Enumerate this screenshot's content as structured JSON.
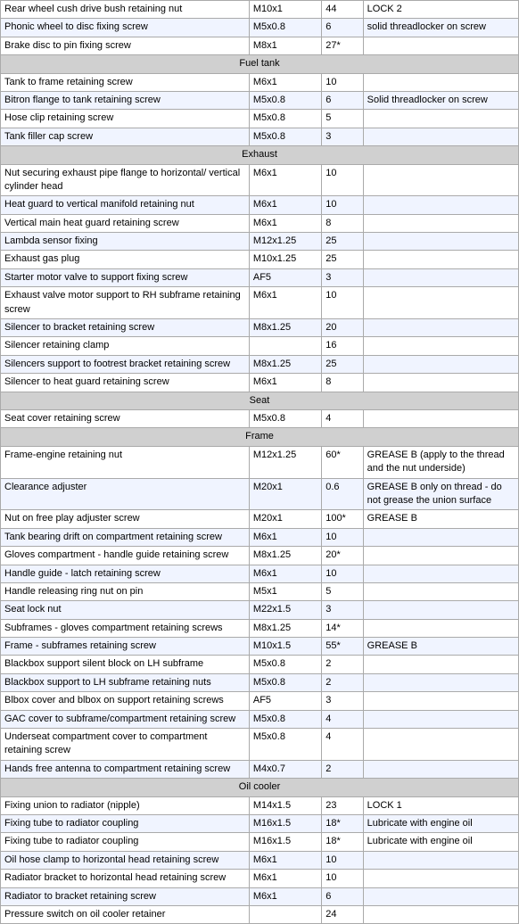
{
  "table": {
    "rows": [
      {
        "type": "data",
        "col1": "Rear wheel cush drive bush retaining nut",
        "col2": "M10x1",
        "col3": "44",
        "col4": "LOCK 2"
      },
      {
        "type": "data",
        "col1": "Phonic wheel to disc fixing screw",
        "col2": "M5x0.8",
        "col3": "6",
        "col4": "solid threadlocker on screw"
      },
      {
        "type": "data",
        "col1": "Brake disc to pin fixing screw",
        "col2": "M8x1",
        "col3": "27*",
        "col4": ""
      },
      {
        "type": "section",
        "label": "Fuel tank"
      },
      {
        "type": "data",
        "col1": "Tank to frame retaining screw",
        "col2": "M6x1",
        "col3": "10",
        "col4": ""
      },
      {
        "type": "data",
        "col1": "Bitron flange to tank retaining screw",
        "col2": "M5x0.8",
        "col3": "6",
        "col4": "Solid threadlocker on screw"
      },
      {
        "type": "data",
        "col1": "Hose clip retaining screw",
        "col2": "M5x0.8",
        "col3": "5",
        "col4": ""
      },
      {
        "type": "data",
        "col1": "Tank filler cap screw",
        "col2": "M5x0.8",
        "col3": "3",
        "col4": ""
      },
      {
        "type": "section",
        "label": "Exhaust"
      },
      {
        "type": "data",
        "col1": "Nut securing exhaust pipe flange to horizontal/ vertical cylinder head",
        "col2": "M6x1",
        "col3": "10",
        "col4": ""
      },
      {
        "type": "data",
        "col1": "Heat guard to vertical manifold retaining nut",
        "col2": "M6x1",
        "col3": "10",
        "col4": ""
      },
      {
        "type": "data",
        "col1": "Vertical main heat guard retaining screw",
        "col2": "M6x1",
        "col3": "8",
        "col4": ""
      },
      {
        "type": "data",
        "col1": "Lambda sensor fixing",
        "col2": "M12x1.25",
        "col3": "25",
        "col4": ""
      },
      {
        "type": "data",
        "col1": "Exhaust gas plug",
        "col2": "M10x1.25",
        "col3": "25",
        "col4": ""
      },
      {
        "type": "data",
        "col1": "Starter motor valve to support fixing screw",
        "col2": "AF5",
        "col3": "3",
        "col4": ""
      },
      {
        "type": "data",
        "col1": "Exhaust valve motor support to RH subframe retaining screw",
        "col2": "M6x1",
        "col3": "10",
        "col4": ""
      },
      {
        "type": "data",
        "col1": "Silencer to bracket retaining screw",
        "col2": "M8x1.25",
        "col3": "20",
        "col4": ""
      },
      {
        "type": "data",
        "col1": "Silencer retaining clamp",
        "col2": "",
        "col3": "16",
        "col4": ""
      },
      {
        "type": "data",
        "col1": "Silencers support to footrest bracket retaining screw",
        "col2": "M8x1.25",
        "col3": "25",
        "col4": ""
      },
      {
        "type": "data",
        "col1": "Silencer to heat guard retaining screw",
        "col2": "M6x1",
        "col3": "8",
        "col4": ""
      },
      {
        "type": "section",
        "label": "Seat"
      },
      {
        "type": "data",
        "col1": "Seat cover retaining screw",
        "col2": "M5x0.8",
        "col3": "4",
        "col4": ""
      },
      {
        "type": "section",
        "label": "Frame"
      },
      {
        "type": "data",
        "col1": "Frame-engine retaining nut",
        "col2": "M12x1.25",
        "col3": "60*",
        "col4": "GREASE B (apply to the thread and the nut underside)"
      },
      {
        "type": "data",
        "col1": "Clearance adjuster",
        "col2": "M20x1",
        "col3": "0.6",
        "col4": "GREASE B only on thread - do not grease the union surface"
      },
      {
        "type": "data",
        "col1": "Nut on free play adjuster screw",
        "col2": "M20x1",
        "col3": "100*",
        "col4": "GREASE B"
      },
      {
        "type": "data",
        "col1": "Tank bearing drift on compartment retaining screw",
        "col2": "M6x1",
        "col3": "10",
        "col4": ""
      },
      {
        "type": "data",
        "col1": "Gloves compartment - handle guide retaining screw",
        "col2": "M8x1.25",
        "col3": "20*",
        "col4": ""
      },
      {
        "type": "data",
        "col1": "Handle guide - latch retaining screw",
        "col2": "M6x1",
        "col3": "10",
        "col4": ""
      },
      {
        "type": "data",
        "col1": "Handle releasing ring nut on pin",
        "col2": "M5x1",
        "col3": "5",
        "col4": ""
      },
      {
        "type": "data",
        "col1": "Seat lock nut",
        "col2": "M22x1.5",
        "col3": "3",
        "col4": ""
      },
      {
        "type": "data",
        "col1": "Subframes - gloves compartment retaining screws",
        "col2": "M8x1.25",
        "col3": "14*",
        "col4": ""
      },
      {
        "type": "data",
        "col1": "Frame - subframes retaining screw",
        "col2": "M10x1.5",
        "col3": "55*",
        "col4": "GREASE B"
      },
      {
        "type": "data",
        "col1": "Blackbox support silent block on LH subframe",
        "col2": "M5x0.8",
        "col3": "2",
        "col4": ""
      },
      {
        "type": "data",
        "col1": "Blackbox support to LH subframe retaining nuts",
        "col2": "M5x0.8",
        "col3": "2",
        "col4": ""
      },
      {
        "type": "data",
        "col1": "Blbox cover and blbox on support retaining screws",
        "col2": "AF5",
        "col3": "3",
        "col4": ""
      },
      {
        "type": "data",
        "col1": "GAC cover to subframe/compartment retaining screw",
        "col2": "M5x0.8",
        "col3": "4",
        "col4": ""
      },
      {
        "type": "data",
        "col1": "Underseat compartment cover to compartment retaining screw",
        "col2": "M5x0.8",
        "col3": "4",
        "col4": ""
      },
      {
        "type": "data",
        "col1": "Hands free antenna to compartment retaining screw",
        "col2": "M4x0.7",
        "col3": "2",
        "col4": ""
      },
      {
        "type": "section",
        "label": "Oil cooler"
      },
      {
        "type": "data",
        "col1": "Fixing union to radiator (nipple)",
        "col2": "M14x1.5",
        "col3": "23",
        "col4": "LOCK 1"
      },
      {
        "type": "data",
        "col1": "Fixing tube to radiator coupling",
        "col2": "M16x1.5",
        "col3": "18*",
        "col4": "Lubricate with engine oil"
      },
      {
        "type": "data",
        "col1": "Fixing tube to radiator coupling",
        "col2": "M16x1.5",
        "col3": "18*",
        "col4": "Lubricate with engine oil"
      },
      {
        "type": "data",
        "col1": "Oil hose clamp to horizontal head retaining screw",
        "col2": "M6x1",
        "col3": "10",
        "col4": ""
      },
      {
        "type": "data",
        "col1": "Radiator bracket to horizontal head retaining screw",
        "col2": "M6x1",
        "col3": "10",
        "col4": ""
      },
      {
        "type": "data",
        "col1": "Radiator to bracket retaining screw",
        "col2": "M6x1",
        "col3": "6",
        "col4": ""
      },
      {
        "type": "data",
        "col1": "Pressure switch on oil cooler retainer",
        "col2": "",
        "col3": "24",
        "col4": ""
      }
    ]
  }
}
